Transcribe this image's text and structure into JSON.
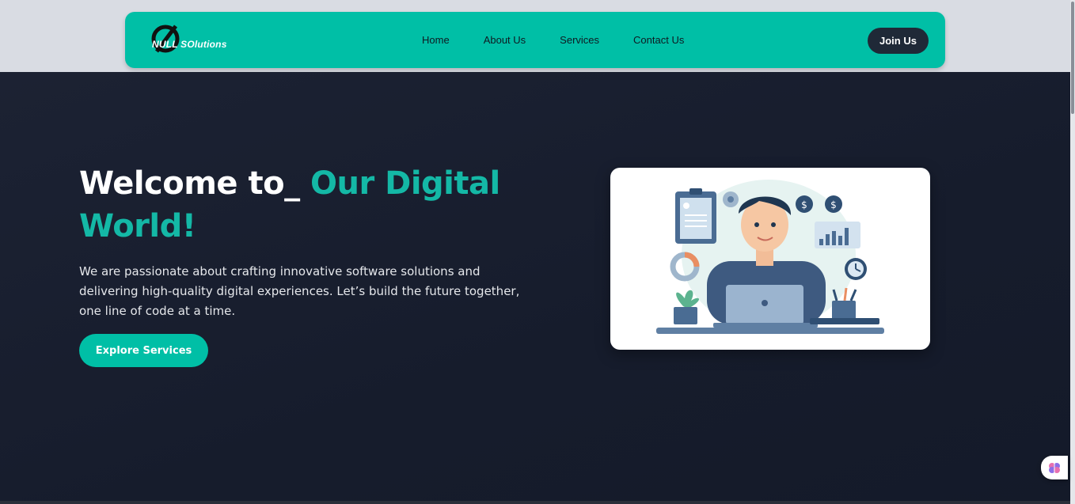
{
  "brand": {
    "name": "NULL SOlutions"
  },
  "nav": {
    "links": [
      "Home",
      "About Us",
      "Services",
      "Contact Us"
    ],
    "join_label": "Join Us"
  },
  "hero": {
    "title_white": "Welcome to_ ",
    "title_accent": "Our Digital World!",
    "description": "We are passionate about crafting innovative software solutions and delivering high-quality digital experiences. Let’s build the future together, one line of code at a time.",
    "cta_label": "Explore Services"
  },
  "colors": {
    "accent": "#00bfa6",
    "accent_text": "#14b8a6",
    "dark": "#1f2937",
    "hero_bg": "#181e2e"
  },
  "icons": {
    "logo": "null-circle-logo",
    "illustration": "developer-laptop-illustration",
    "fab": "brain-icon"
  }
}
